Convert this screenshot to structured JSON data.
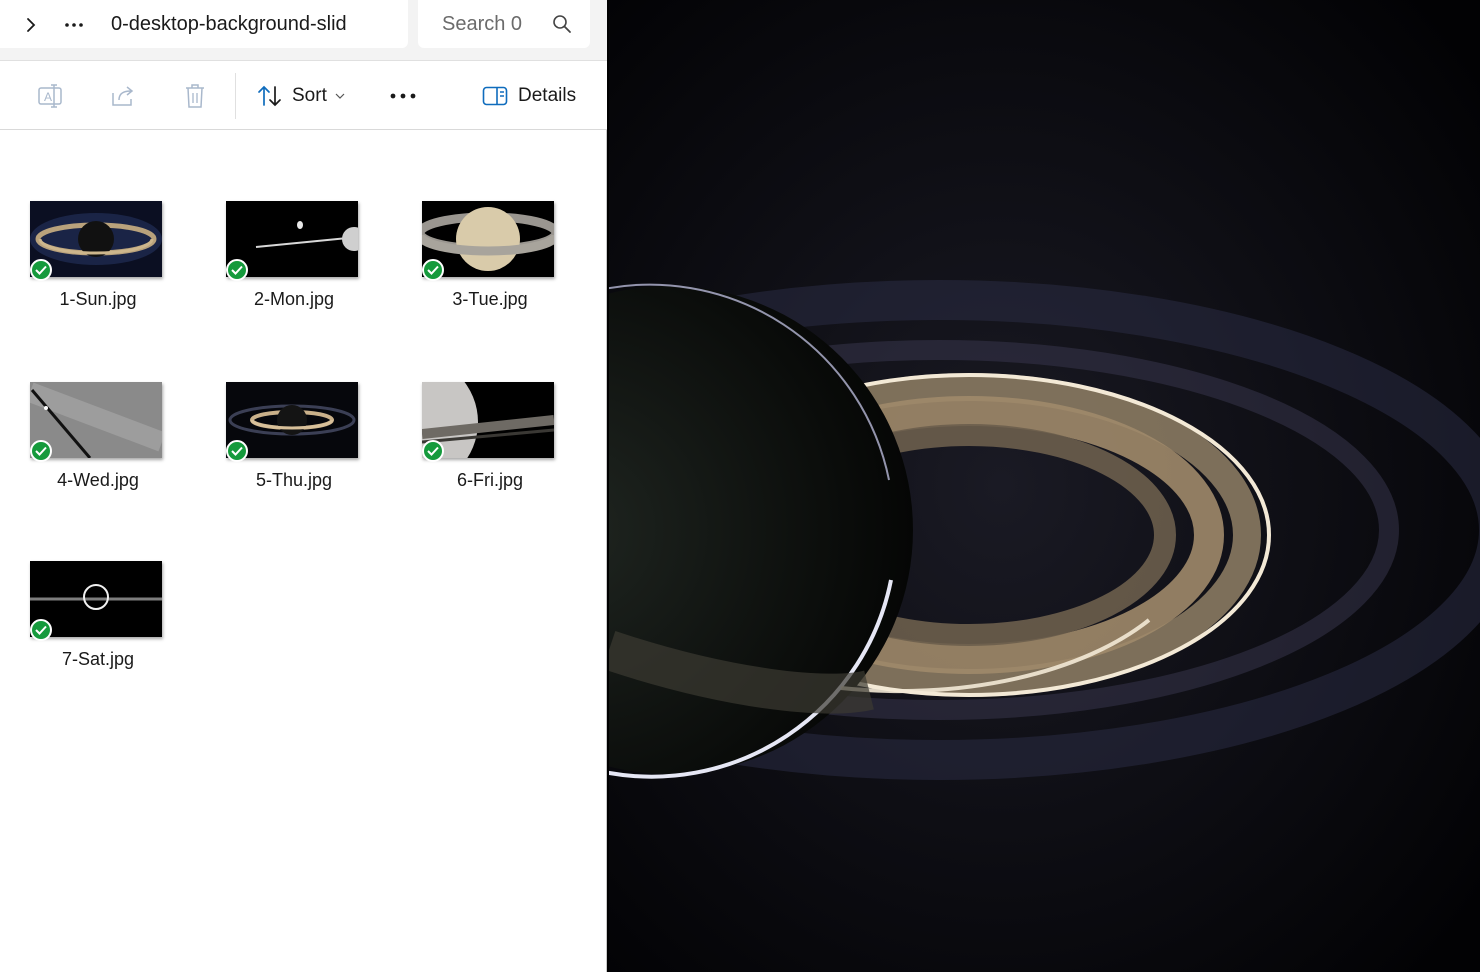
{
  "address": {
    "path_text": "0-desktop-background-slid",
    "search_placeholder": "Search 0"
  },
  "toolbar": {
    "sort_label": "Sort",
    "details_label": "Details"
  },
  "files": [
    {
      "name": "1-Sun.jpg",
      "synced": true
    },
    {
      "name": "2-Mon.jpg",
      "synced": true
    },
    {
      "name": "3-Tue.jpg",
      "synced": true
    },
    {
      "name": "4-Wed.jpg",
      "synced": true
    },
    {
      "name": "5-Thu.jpg",
      "synced": true
    },
    {
      "name": "6-Fri.jpg",
      "synced": true
    },
    {
      "name": "7-Sat.jpg",
      "synced": true
    }
  ],
  "colors": {
    "accent": "#0f6cbd",
    "sync_check": "#159a3c"
  }
}
